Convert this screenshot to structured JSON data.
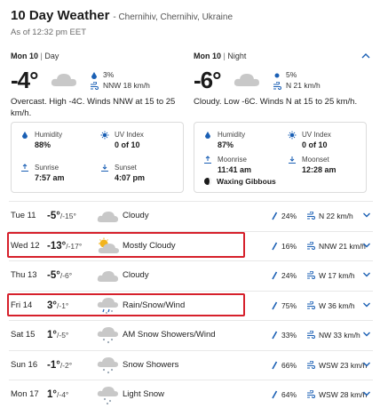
{
  "header": {
    "title": "10 Day Weather",
    "location": "- Chernihiv, Chernihiv, Ukraine",
    "as_of": "As of 12:32 pm EET"
  },
  "day": {
    "date": "Mon 10",
    "sep": "|",
    "period": "Day",
    "temp": "-4°",
    "precip": "3%",
    "wind": "NNW 18 km/h",
    "summary": "Overcast. High -4C. Winds NNW at 15 to 25 km/h.",
    "humidity_label": "Humidity",
    "humidity": "88%",
    "uv_label": "UV Index",
    "uv": "0 of 10",
    "sunrise_label": "Sunrise",
    "sunrise": "7:57 am",
    "sunset_label": "Sunset",
    "sunset": "4:07 pm"
  },
  "night": {
    "date": "Mon 10",
    "sep": "|",
    "period": "Night",
    "temp": "-6°",
    "precip": "5%",
    "wind": "N 21 km/h",
    "summary": "Cloudy. Low -6C. Winds N at 15 to 25 km/h.",
    "humidity_label": "Humidity",
    "humidity": "87%",
    "uv_label": "UV Index",
    "uv": "0 of 10",
    "moonrise_label": "Moonrise",
    "moonrise": "11:41 am",
    "moonset_label": "Moonset",
    "moonset": "12:28 am",
    "moon_phase": "Waxing Gibbous"
  },
  "days": [
    {
      "date": "Tue 11",
      "hi": "-5°",
      "lo": "/-15°",
      "icon": "cloudy-icon",
      "cond": "Cloudy",
      "precip": "24%",
      "wind": "N 22 km/h"
    },
    {
      "date": "Wed 12",
      "hi": "-13°",
      "lo": "/-17°",
      "icon": "mostly-cloudy-icon",
      "cond": "Mostly Cloudy",
      "precip": "16%",
      "wind": "NNW 21 km/h"
    },
    {
      "date": "Thu 13",
      "hi": "-5°",
      "lo": "/-6°",
      "icon": "cloudy-icon",
      "cond": "Cloudy",
      "precip": "24%",
      "wind": "W 17 km/h"
    },
    {
      "date": "Fri 14",
      "hi": "3°",
      "lo": "/-1°",
      "icon": "rain-snow-icon",
      "cond": "Rain/Snow/Wind",
      "precip": "75%",
      "wind": "W 36 km/h"
    },
    {
      "date": "Sat 15",
      "hi": "1°",
      "lo": "/-5°",
      "icon": "snow-showers-icon",
      "cond": "AM Snow Showers/Wind",
      "precip": "33%",
      "wind": "NW 33 km/h"
    },
    {
      "date": "Sun 16",
      "hi": "-1°",
      "lo": "/-2°",
      "icon": "snow-showers-icon",
      "cond": "Snow Showers",
      "precip": "66%",
      "wind": "WSW 23 km/h"
    },
    {
      "date": "Mon 17",
      "hi": "1°",
      "lo": "/-4°",
      "icon": "snow-icon",
      "cond": "Light Snow",
      "precip": "64%",
      "wind": "WSW 28 km/h"
    }
  ],
  "colors": {
    "accent": "#1a5fb4",
    "highlight": "#d6202b",
    "cloud": "#c8c8c8"
  }
}
